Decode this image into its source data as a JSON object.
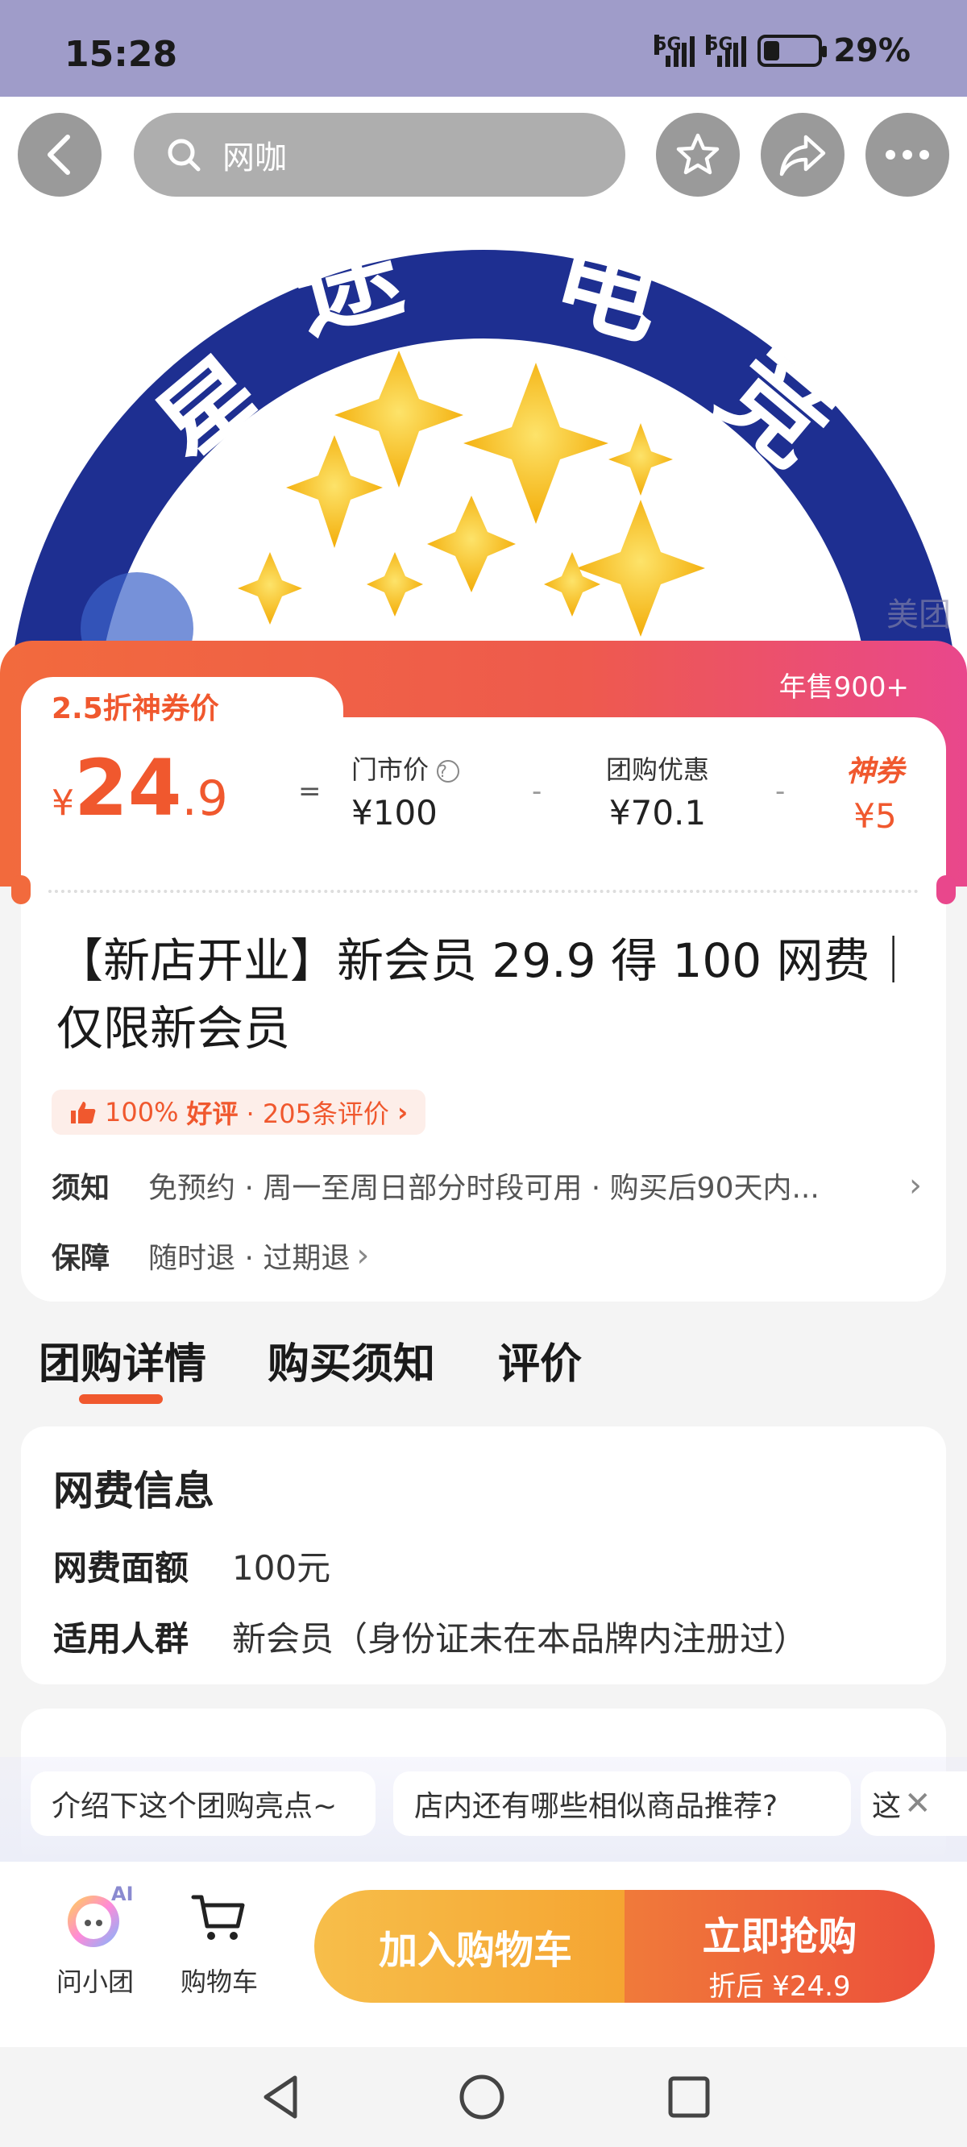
{
  "status": {
    "time": "15:28",
    "net1": "5G",
    "net2": "5G",
    "battery": "29%",
    "battery_level": 0.29
  },
  "header": {
    "search_text": "网咖"
  },
  "hero": {
    "logo_text": [
      "星",
      "途",
      "电",
      "竞"
    ],
    "watermark": "美团"
  },
  "price": {
    "tag": "2.5折神券价",
    "sold": "年售900+",
    "currency": "¥",
    "amount_int": "24",
    "amount_dec": ".9",
    "eq": "=",
    "minus": "-",
    "store_label": "门市价",
    "store_value": "¥100",
    "group_label": "团购优惠",
    "group_value": "¥70.1",
    "coupon_label": "神券",
    "coupon_value": "¥5"
  },
  "deal": {
    "title": "【新店开业】新会员 29.9 得 100 网费｜仅限新会员",
    "rating_pct": "100%",
    "rating_word": "好评",
    "rating_count": "· 205条评价",
    "notice_key": "须知",
    "notice_val": "免预约 · 周一至周日部分时段可用 · 购买后90天内...",
    "guarantee_key": "保障",
    "guarantee_val": "随时退 · 过期退"
  },
  "tabs": [
    "团购详情",
    "购买须知",
    "评价"
  ],
  "fee": {
    "title": "网费信息",
    "rows": [
      {
        "k": "网费面额",
        "v": "100元"
      },
      {
        "k": "适用人群",
        "v": "新会员（身份证未在本品牌内注册过）"
      }
    ]
  },
  "chips": [
    "介绍下这个团购亮点~",
    "店内还有哪些相似商品推荐?",
    "这"
  ],
  "bottom": {
    "ai_label": "问小团",
    "ai_badge": "AI",
    "cart_label": "购物车",
    "add_cart": "加入购物车",
    "buy": "立即抢购",
    "buy_sub": "折后 ¥24.9"
  },
  "colors": {
    "accent": "#f0582e",
    "hero_blue": "#1e2f91",
    "star": "#f6b400"
  }
}
